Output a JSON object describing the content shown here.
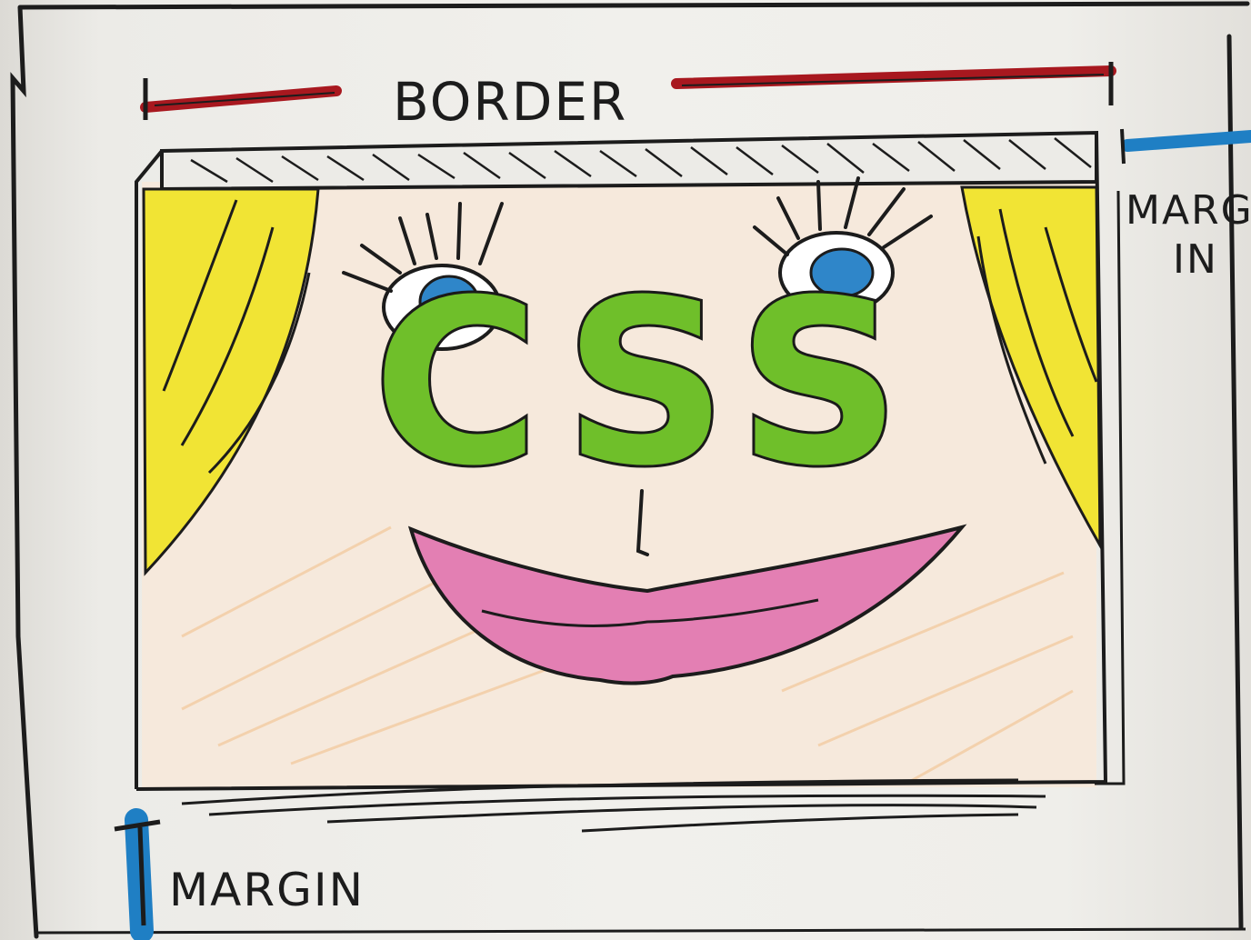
{
  "labels": {
    "border": "BORDER",
    "margin_right_line1": "MARG",
    "margin_right_line2": "IN",
    "margin_bottom": "MARGIN"
  },
  "drawing": {
    "center_text": "CSS"
  },
  "colors": {
    "paper": "#efeeea",
    "ink": "#1c1c1c",
    "border_marker": "#a8181f",
    "margin_marker": "#1f7fc4",
    "curtain": "#f1e434",
    "css_letters": "#6fbf2a",
    "iris": "#2f86c9",
    "lips": "#e37fb3",
    "stage_shading": "#f3c89a"
  },
  "icons": [
    "curtain-left",
    "curtain-right",
    "eye-left",
    "eye-right",
    "nose",
    "lips"
  ]
}
